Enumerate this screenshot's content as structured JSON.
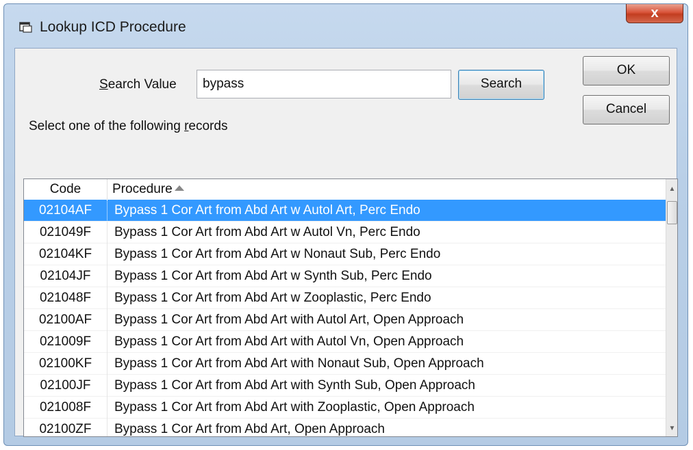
{
  "window": {
    "title": "Lookup ICD Procedure",
    "close_label": "x"
  },
  "search": {
    "label_accel": "S",
    "label_rest": "earch Value",
    "value": "bypass",
    "button_label": "Search"
  },
  "buttons": {
    "ok_label": "OK",
    "cancel_label": "Cancel"
  },
  "instructions": {
    "prefix": "Select one of the following ",
    "accel": "r",
    "suffix": "ecords"
  },
  "table": {
    "columns": {
      "code": "Code",
      "procedure": "Procedure"
    },
    "sort_column": "procedure",
    "sort_direction": "ascending",
    "selected_index": 0,
    "rows": [
      {
        "code": "02104AF",
        "procedure": "Bypass 1 Cor Art from Abd Art w Autol Art, Perc Endo"
      },
      {
        "code": "021049F",
        "procedure": "Bypass 1 Cor Art from Abd Art w Autol Vn, Perc Endo"
      },
      {
        "code": "02104KF",
        "procedure": "Bypass 1 Cor Art from Abd Art w Nonaut Sub, Perc Endo"
      },
      {
        "code": "02104JF",
        "procedure": "Bypass 1 Cor Art from Abd Art w Synth Sub, Perc Endo"
      },
      {
        "code": "021048F",
        "procedure": "Bypass 1 Cor Art from Abd Art w Zooplastic, Perc Endo"
      },
      {
        "code": "02100AF",
        "procedure": "Bypass 1 Cor Art from Abd Art with Autol Art, Open Approach"
      },
      {
        "code": "021009F",
        "procedure": "Bypass 1 Cor Art from Abd Art with Autol Vn, Open Approach"
      },
      {
        "code": "02100KF",
        "procedure": "Bypass 1 Cor Art from Abd Art with Nonaut Sub, Open Approach"
      },
      {
        "code": "02100JF",
        "procedure": "Bypass 1 Cor Art from Abd Art with Synth Sub, Open Approach"
      },
      {
        "code": "021008F",
        "procedure": "Bypass 1 Cor Art from Abd Art with Zooplastic, Open Approach"
      },
      {
        "code": "02100ZF",
        "procedure": "Bypass 1 Cor Art from Abd Art, Open Approach"
      }
    ]
  },
  "colors": {
    "selection": "#3399ff",
    "close_button": "#c94a2c"
  },
  "icons": {
    "app": "window-icon",
    "sort": "sort-up-icon",
    "scroll_up": "scroll-up-icon",
    "scroll_down": "scroll-down-icon"
  }
}
